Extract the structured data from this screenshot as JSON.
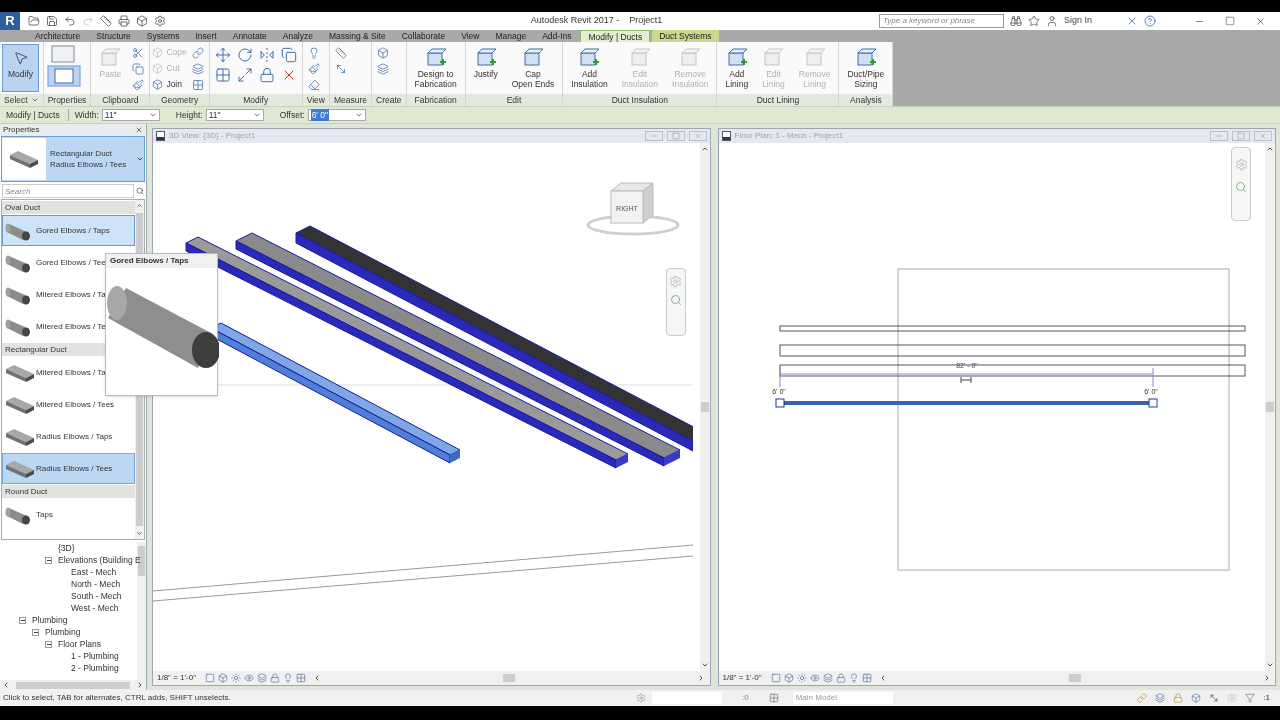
{
  "title_bar": {
    "logo": "R",
    "title": "Autodesk Revit 2017 -",
    "document": "Project1",
    "search_placeholder": "Type a keyword or phrase",
    "sign_in": "Sign In"
  },
  "tabs": [
    {
      "label": "Architecture",
      "selected": false,
      "kind": "normal"
    },
    {
      "label": "Structure",
      "selected": false,
      "kind": "normal"
    },
    {
      "label": "Systems",
      "selected": false,
      "kind": "normal"
    },
    {
      "label": "Insert",
      "selected": false,
      "kind": "normal"
    },
    {
      "label": "Annotate",
      "selected": false,
      "kind": "normal"
    },
    {
      "label": "Analyze",
      "selected": false,
      "kind": "normal"
    },
    {
      "label": "Massing & Site",
      "selected": false,
      "kind": "normal"
    },
    {
      "label": "Collaborate",
      "selected": false,
      "kind": "normal"
    },
    {
      "label": "View",
      "selected": false,
      "kind": "normal"
    },
    {
      "label": "Manage",
      "selected": false,
      "kind": "normal"
    },
    {
      "label": "Add-Ins",
      "selected": false,
      "kind": "normal"
    },
    {
      "label": "Modify | Ducts",
      "selected": true,
      "kind": "contextual"
    },
    {
      "label": "Duct Systems",
      "selected": false,
      "kind": "contextual"
    }
  ],
  "ribbon": [
    {
      "label": "Select",
      "menu": true,
      "tools": [
        {
          "label": "Modify",
          "kind": "large",
          "selected": true,
          "disabled": false
        }
      ]
    },
    {
      "label": "Properties",
      "menu": false
    },
    {
      "label": "Clipboard",
      "menu": false,
      "tools": [
        {
          "label": "Paste",
          "kind": "large",
          "selected": false,
          "disabled": true
        }
      ]
    },
    {
      "label": "Geometry",
      "menu": false,
      "tools": [
        {
          "label": "Cope",
          "kind": "small",
          "selected": false,
          "disabled": true
        },
        {
          "label": "Cut",
          "kind": "small",
          "selected": false,
          "disabled": true
        },
        {
          "label": "Join",
          "kind": "small",
          "selected": false,
          "disabled": false
        }
      ]
    },
    {
      "label": "Modify",
      "menu": false
    },
    {
      "label": "View",
      "menu": false
    },
    {
      "label": "Measure",
      "menu": false
    },
    {
      "label": "Create",
      "menu": false
    },
    {
      "label": "Fabrication",
      "menu": false,
      "tools": [
        {
          "label": "Design to\nFabrication",
          "kind": "large",
          "selected": false,
          "disabled": false
        }
      ]
    },
    {
      "label": "Edit",
      "menu": false,
      "tools": [
        {
          "label": "Justify",
          "kind": "large",
          "selected": false,
          "disabled": false
        },
        {
          "label": "Cap\nOpen Ends",
          "kind": "large",
          "selected": false,
          "disabled": false
        }
      ]
    },
    {
      "label": "Duct Insulation",
      "menu": false,
      "tools": [
        {
          "label": "Add\nInsulation",
          "kind": "large",
          "selected": false,
          "disabled": false
        },
        {
          "label": "Edit\nInsulation",
          "kind": "large",
          "selected": false,
          "disabled": true
        },
        {
          "label": "Remove\nInsulation",
          "kind": "large",
          "selected": false,
          "disabled": true
        }
      ]
    },
    {
      "label": "Duct Lining",
      "menu": false,
      "tools": [
        {
          "label": "Add\nLining",
          "kind": "large",
          "selected": false,
          "disabled": false
        },
        {
          "label": "Edit\nLining",
          "kind": "large",
          "selected": false,
          "disabled": true
        },
        {
          "label": "Remove\nLining",
          "kind": "large",
          "selected": false,
          "disabled": true
        }
      ]
    },
    {
      "label": "Analysis",
      "menu": false,
      "tools": [
        {
          "label": "Duct/Pipe\nSizing",
          "kind": "large",
          "selected": false,
          "disabled": false
        }
      ]
    }
  ],
  "options_bar": {
    "context": "Modify | Ducts",
    "fields": [
      {
        "label": "Width:",
        "value": "11\"",
        "selected": false
      },
      {
        "label": "Height:",
        "value": "11\"",
        "selected": false
      },
      {
        "label": "Offset:",
        "value": "6' 0\"",
        "selected": true
      }
    ]
  },
  "properties": {
    "title": "Properties",
    "type": {
      "family": "Rectangular Duct",
      "name": "Radius Elbows / Tees"
    },
    "search_placeholder": "Search",
    "groups": [
      {
        "heading": "Oval Duct",
        "items": [
          {
            "label": "Gored Elbows / Taps",
            "kind": "oval",
            "selected": false,
            "hovered": true
          },
          {
            "label": "Gored Elbows / Tee",
            "kind": "oval",
            "selected": false,
            "hovered": false
          },
          {
            "label": "Mitered Elbows / Ta",
            "kind": "oval",
            "selected": false,
            "hovered": false
          },
          {
            "label": "Mitered Elbows / Te",
            "kind": "oval",
            "selected": false,
            "hovered": false
          }
        ]
      },
      {
        "heading": "Rectangular Duct",
        "items": [
          {
            "label": "Mitered Elbows / Ta",
            "kind": "rect",
            "selected": false,
            "hovered": false
          },
          {
            "label": "Mitered Elbows / Tees",
            "kind": "rect",
            "selected": false,
            "hovered": false
          },
          {
            "label": "Radius Elbows / Taps",
            "kind": "rect",
            "selected": false,
            "hovered": false
          },
          {
            "label": "Radius Elbows / Tees",
            "kind": "rect",
            "selected": true,
            "hovered": false
          }
        ]
      },
      {
        "heading": "Round Duct",
        "items": [
          {
            "label": "Taps",
            "kind": "oval",
            "selected": false,
            "hovered": false
          }
        ]
      }
    ]
  },
  "tooltip": {
    "title": "Gored Elbows / Taps"
  },
  "browser": [
    {
      "children": [
        {
          "children": [
            {
              "label": "{3D}"
            },
            {
              "label": "Elevations (Building E",
              "expanded": true,
              "children": [
                {
                  "label": "East - Mech"
                },
                {
                  "label": "North - Mech"
                },
                {
                  "label": "South - Mech"
                },
                {
                  "label": "West - Mech"
                }
              ]
            }
          ]
        }
      ]
    },
    {
      "label": "Plumbing",
      "expanded": true,
      "children": [
        {
          "label": "Plumbing",
          "expanded": true,
          "children": [
            {
              "label": "Floor Plans",
              "expanded": true,
              "children": [
                {
                  "label": "1 - Plumbing"
                },
                {
                  "label": "2 - Plumbing"
                }
              ]
            }
          ]
        }
      ]
    }
  ],
  "views": [
    {
      "kind": "model",
      "title": "3D View: {3D} - Project1",
      "active": false,
      "scale": "1/8\" = 1'-0\"",
      "view_cube": "RIGHT"
    },
    {
      "kind": "plan",
      "title": "Floor Plan: 1 - Mech - Project1",
      "active": false,
      "scale": "1/8\" = 1'-0\"",
      "dimension": "82' - 0\"",
      "offsets": [
        "6' 0\"",
        "6' 0\""
      ]
    }
  ],
  "status_bar": {
    "hint": "Click to select, TAB for alternates, CTRL adds, SHIFT unselects.",
    "worksets": ":0",
    "model": "Main Model",
    "filter": ":1"
  }
}
